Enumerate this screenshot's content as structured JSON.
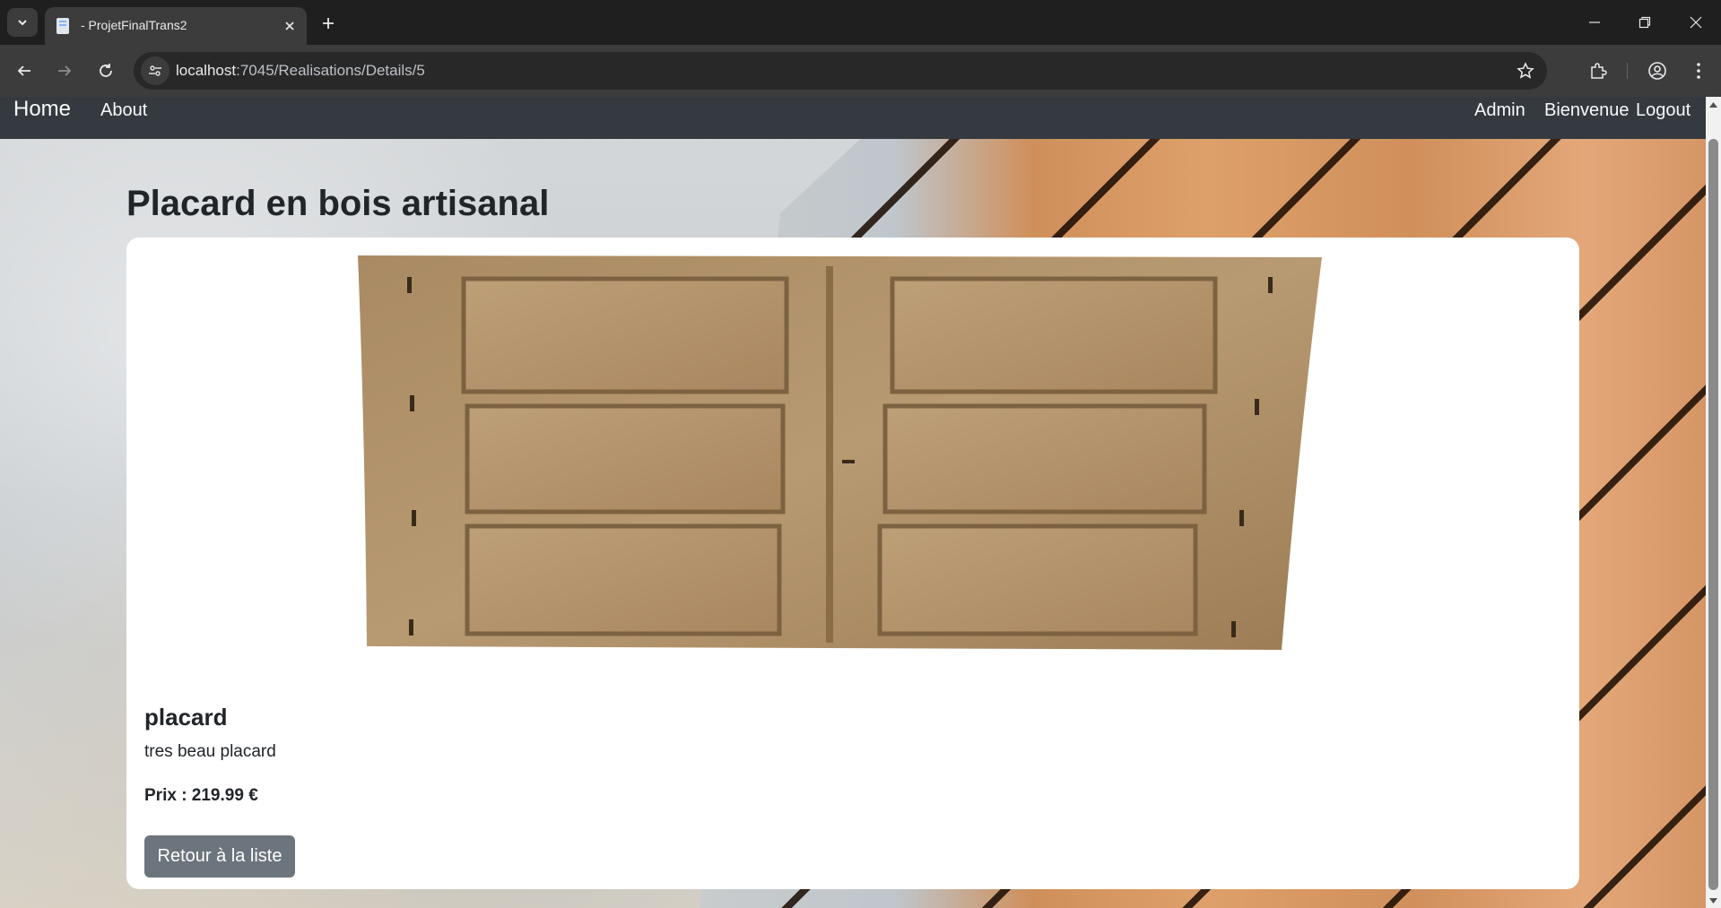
{
  "browser": {
    "tab_title": "- ProjetFinalTrans2",
    "url_host": "localhost",
    "url_path": ":7045/Realisations/Details/5"
  },
  "navbar": {
    "brand": "Home",
    "about": "About",
    "admin": "Admin",
    "welcome": "Bienvenue",
    "logout": "Logout"
  },
  "page": {
    "title": "Placard en bois artisanal"
  },
  "item": {
    "name": "placard",
    "description": "tres beau placard",
    "price": "Prix : 219.99 €",
    "back_label": "Retour à la liste"
  },
  "colors": {
    "navbar_bg": "#343a40",
    "button_bg": "#6c757d"
  }
}
